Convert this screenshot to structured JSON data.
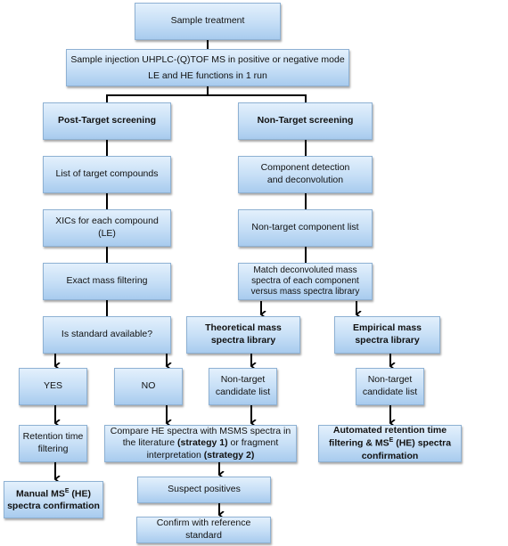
{
  "nodes": {
    "sample_treatment": "Sample treatment",
    "injection_line1": "Sample injection UHPLC-(Q)TOF MS in positive or negative mode",
    "injection_line2": "LE and HE functions in 1 run",
    "post_target": "Post-Target screening",
    "non_target": "Non-Target screening",
    "list_targets": "List of target compounds",
    "component_detection": "Component detection and deconvolution",
    "xics": "XICs for each compound (LE)",
    "non_target_list": "Non-target component list",
    "exact_mass": "Exact mass filtering",
    "match_spectra": "Match deconvoluted mass spectra of each component versus mass spectra library",
    "standard_available": "Is  standard available?",
    "theoretical_library": "Theoretical mass spectra library",
    "empirical_library": "Empirical mass spectra library",
    "yes": "YES",
    "no": "NO",
    "candidate_list_theoretical": "Non-target candidate list",
    "candidate_list_empirical": "Non-target candidate list",
    "retention_filtering": "Retention time filtering",
    "compare_part1": "Compare HE spectra with MSMS spectra in the literature ",
    "compare_strategy1": "(strategy 1)",
    "compare_part2": " or fragment interpretation ",
    "compare_strategy2": "(strategy 2)",
    "automated_part1": "Automated  retention time filtering & MS",
    "automated_sup": "E",
    "automated_part2": " (HE) spectra confirmation",
    "manual_part1": "Manual MS",
    "manual_sup": "E",
    "manual_part2": " (HE) spectra confirmation",
    "suspect_positives": "Suspect positives",
    "confirm_reference": "Confirm with reference standard"
  },
  "colors": {
    "box_fill": "#c5def6",
    "box_border": "#8eb1d3",
    "connector": "#000000"
  }
}
